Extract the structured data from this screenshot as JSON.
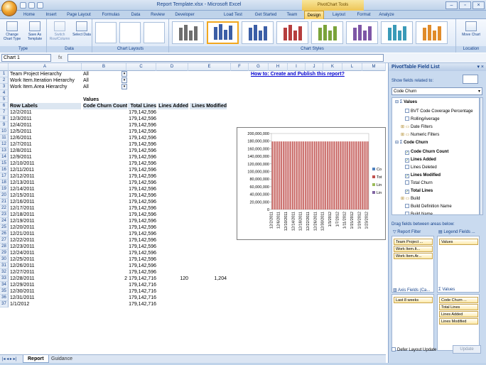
{
  "window": {
    "title": "Report Template.xlsx - Microsoft Excel",
    "context_tab": "PivotChart Tools"
  },
  "tabs": [
    "Home",
    "Insert",
    "Page Layout",
    "Formulas",
    "Data",
    "Review",
    "Developer",
    "Load Test",
    "Get Started",
    "Team",
    "Design",
    "Layout",
    "Format",
    "Analyze"
  ],
  "ribbon": {
    "groups": [
      {
        "label": "Type"
      },
      {
        "label": "Data"
      },
      {
        "label": "Chart Layouts"
      },
      {
        "label": "Chart Styles"
      },
      {
        "label": "Location"
      }
    ],
    "buttons": {
      "change_type": "Change Chart Type",
      "save_template": "Save As Template",
      "switch_rowcol": "Switch Row/Column",
      "select_data": "Select Data",
      "move_chart": "Move Chart"
    },
    "style_colors": [
      "#6e6e6e",
      "#3b5ea6",
      "#3b5ea6",
      "#b63e3e",
      "#7aa33a",
      "#7e56a6",
      "#3a9ab8",
      "#e08b2a"
    ]
  },
  "namebox": "Chart 1",
  "columns": [
    "A",
    "B",
    "C",
    "D",
    "E",
    "F",
    "G",
    "H",
    "I",
    "J",
    "K",
    "L",
    "M"
  ],
  "filters": [
    {
      "label": "Team Project Hierarchy",
      "value": "All"
    },
    {
      "label": "Work Item.Iteration Hierarchy",
      "value": "All"
    },
    {
      "label": "Work Item.Area Hierarchy",
      "value": "All"
    }
  ],
  "link_text": "How to: Create and Publish this report?",
  "values_caption": "Values",
  "headers": [
    "Row Labels",
    "Code Churn Count",
    "Total Lines",
    "Lines Added",
    "Lines Modified"
  ],
  "rows": [
    [
      "12/2/2011",
      "",
      "179,142,596",
      "",
      ""
    ],
    [
      "12/3/2011",
      "",
      "179,142,596",
      "",
      ""
    ],
    [
      "12/4/2011",
      "",
      "179,142,596",
      "",
      ""
    ],
    [
      "12/5/2011",
      "",
      "179,142,596",
      "",
      ""
    ],
    [
      "12/6/2011",
      "",
      "179,142,596",
      "",
      ""
    ],
    [
      "12/7/2011",
      "",
      "179,142,596",
      "",
      ""
    ],
    [
      "12/8/2011",
      "",
      "179,142,596",
      "",
      ""
    ],
    [
      "12/9/2011",
      "",
      "179,142,596",
      "",
      ""
    ],
    [
      "12/10/2011",
      "",
      "179,142,596",
      "",
      ""
    ],
    [
      "12/11/2011",
      "",
      "179,142,596",
      "",
      ""
    ],
    [
      "12/12/2011",
      "",
      "179,142,596",
      "",
      ""
    ],
    [
      "12/13/2011",
      "",
      "179,142,596",
      "",
      ""
    ],
    [
      "12/14/2011",
      "",
      "179,142,596",
      "",
      ""
    ],
    [
      "12/15/2011",
      "",
      "179,142,596",
      "",
      ""
    ],
    [
      "12/16/2011",
      "",
      "179,142,596",
      "",
      ""
    ],
    [
      "12/17/2011",
      "",
      "179,142,596",
      "",
      ""
    ],
    [
      "12/18/2011",
      "",
      "179,142,596",
      "",
      ""
    ],
    [
      "12/19/2011",
      "",
      "179,142,596",
      "",
      ""
    ],
    [
      "12/20/2011",
      "",
      "179,142,596",
      "",
      ""
    ],
    [
      "12/21/2011",
      "",
      "179,142,596",
      "",
      ""
    ],
    [
      "12/22/2011",
      "",
      "179,142,596",
      "",
      ""
    ],
    [
      "12/23/2011",
      "",
      "179,142,596",
      "",
      ""
    ],
    [
      "12/24/2011",
      "",
      "179,142,596",
      "",
      ""
    ],
    [
      "12/25/2011",
      "",
      "179,142,596",
      "",
      ""
    ],
    [
      "12/26/2011",
      "",
      "179,142,596",
      "",
      ""
    ],
    [
      "12/27/2011",
      "",
      "179,142,596",
      "",
      ""
    ],
    [
      "12/28/2011",
      "2",
      "179,142,716",
      "120",
      "1,204"
    ],
    [
      "12/29/2011",
      "",
      "179,142,716",
      "",
      ""
    ],
    [
      "12/30/2011",
      "",
      "179,142,716",
      "",
      ""
    ],
    [
      "12/31/2011",
      "",
      "179,142,716",
      "",
      ""
    ],
    [
      "1/1/2012",
      "",
      "179,142,716",
      "",
      ""
    ]
  ],
  "sheet_tabs": [
    "Report",
    "Guidance"
  ],
  "chart_data": {
    "type": "bar",
    "title": "",
    "categories": [
      "12/2/2011",
      "12/6/2011",
      "12/10/2011",
      "12/14/2011",
      "12/18/2011",
      "12/22/2011",
      "12/26/2011",
      "12/30/2011",
      "1/3/2012",
      "1/7/2012",
      "1/11/2012",
      "1/15/2012",
      "1/19/2012",
      "1/23/2012"
    ],
    "series": [
      {
        "name": "Co",
        "color": "#4f81bd"
      },
      {
        "name": "Tot",
        "color": "#c0504d"
      },
      {
        "name": "Lin",
        "color": "#9bbb59"
      },
      {
        "name": "Lin",
        "color": "#8064a2"
      }
    ],
    "bar_count": 53,
    "bar_value": 179142596,
    "y_ticks": [
      "200,000,000",
      "180,000,000",
      "160,000,000",
      "140,000,000",
      "120,000,000",
      "100,000,000",
      "80,000,000",
      "60,000,000",
      "40,000,000",
      "20,000,000",
      "0"
    ],
    "ylim": [
      0,
      200000000
    ]
  },
  "pane": {
    "title": "PivotTable Field List",
    "show_fields": "Show fields related to:",
    "combo": "Code Churn",
    "fields": [
      {
        "label": "Values",
        "type": "group"
      },
      {
        "label": "BVT Code Coverage Percentage",
        "type": "sub"
      },
      {
        "label": "RollingAverage",
        "type": "sub"
      },
      {
        "label": "Date Filters",
        "type": "folder"
      },
      {
        "label": "Numeric Filters",
        "type": "folder"
      },
      {
        "label": "Code Churn",
        "type": "group"
      },
      {
        "label": "Code Churn Count",
        "type": "check",
        "checked": true
      },
      {
        "label": "Lines Added",
        "type": "check",
        "checked": true
      },
      {
        "label": "Lines Deleted",
        "type": "check",
        "checked": false
      },
      {
        "label": "Lines Modified",
        "type": "check",
        "checked": true
      },
      {
        "label": "Total Churn",
        "type": "check",
        "checked": false
      },
      {
        "label": "Total Lines",
        "type": "check",
        "checked": true
      },
      {
        "label": "Build",
        "type": "folder"
      },
      {
        "label": "Build Definition Name",
        "type": "check",
        "checked": false
      },
      {
        "label": "Build Name",
        "type": "check",
        "checked": false
      }
    ],
    "drag_label": "Drag fields between areas below:",
    "report_filter": "Report Filter",
    "legend_fields": "Legend Fields ...",
    "axis_fields": "Axis Fields (Ca...",
    "values_area": "Values",
    "filter_chips": [
      "Team Project ...",
      "Work Item.It...",
      "Work Item.Ar..."
    ],
    "legend_chips": [
      "Values"
    ],
    "axis_chips": [
      "Last 8 weeks"
    ],
    "value_chips": [
      "Code Churn ...",
      "Total Lines",
      "Lines Added",
      "Lines Modified"
    ],
    "defer": "Defer Layout Update",
    "update": "Update"
  }
}
